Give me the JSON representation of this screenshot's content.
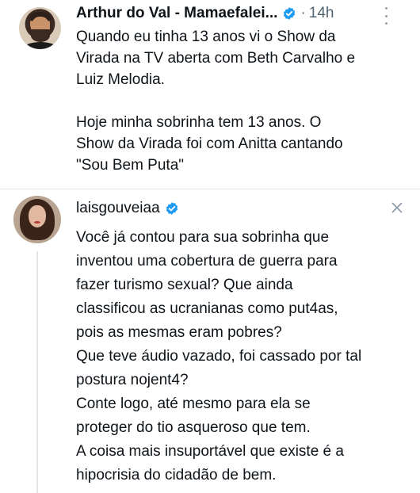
{
  "post": {
    "author_name": "Arthur do Val - Mamaefalei...",
    "separator": "·",
    "time": "14h",
    "lines": [
      "Quando eu tinha 13 anos vi o Show da",
      "Virada na TV aberta com Beth Carvalho e",
      "Luiz Melodia.",
      "",
      "Hoje minha sobrinha tem 13 anos. O",
      "Show da Virada foi com Anitta cantando",
      "\"Sou Bem Puta\""
    ]
  },
  "reply": {
    "username": "laisgouveiaa",
    "lines": [
      "Você já contou para sua sobrinha que",
      "inventou uma cobertura de guerra para",
      "fazer turismo sexual? Que ainda",
      "classificou as ucranianas como put4as,",
      "pois as mesmas eram pobres?",
      "Que teve áudio vazado, foi cassado por tal",
      "postura nojent4?",
      "Conte logo, até mesmo para ela se",
      "proteger do tio asqueroso que tem.",
      "A coisa mais insuportável que existe é a",
      "hipocrisia do cidadão de bem."
    ]
  },
  "icons": {
    "verified_badge": "verified-badge-icon",
    "more": "more-options-icon",
    "close": "close-icon"
  },
  "colors": {
    "verified_blue": "#1d9bf0",
    "muted_text": "#536471",
    "text": "#0f1419"
  }
}
